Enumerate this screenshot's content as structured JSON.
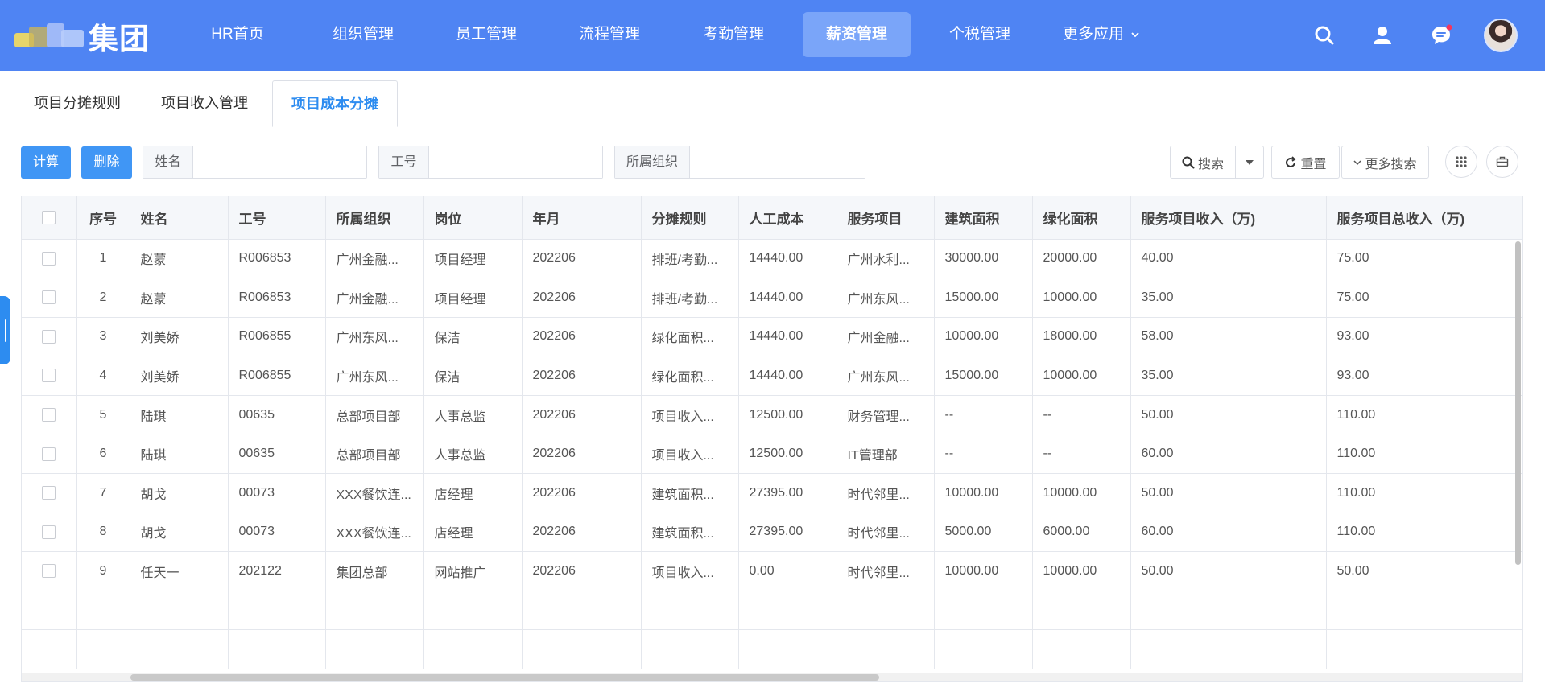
{
  "brand": {
    "logo_text": "集团"
  },
  "nav": {
    "items": [
      "HR首页",
      "组织管理",
      "员工管理",
      "流程管理",
      "考勤管理",
      "薪资管理",
      "个税管理",
      "更多应用"
    ],
    "active": "薪资管理"
  },
  "icons": [
    "search-icon",
    "user-icon",
    "message-icon",
    "avatar"
  ],
  "tabs": {
    "items": [
      "项目分摊规则",
      "项目收入管理",
      "项目成本分摊"
    ],
    "active": "项目成本分摊"
  },
  "toolbar": {
    "calc": "计算",
    "delete": "删除",
    "name_label": "姓名",
    "id_label": "工号",
    "org_label": "所属组织",
    "search": "搜索",
    "reset": "重置",
    "more_search": "更多搜索"
  },
  "table": {
    "headers": [
      "序号",
      "姓名",
      "工号",
      "所属组织",
      "岗位",
      "年月",
      "分摊规则",
      "人工成本",
      "服务项目",
      "建筑面积",
      "绿化面积",
      "服务项目收入（万)",
      "服务项目总收入（万)"
    ],
    "rows": [
      [
        "1",
        "赵蒙",
        "R006853",
        "广州金融...",
        "项目经理",
        "202206",
        "排班/考勤...",
        "14440.00",
        "广州水利...",
        "30000.00",
        "20000.00",
        "40.00",
        "75.00"
      ],
      [
        "2",
        "赵蒙",
        "R006853",
        "广州金融...",
        "项目经理",
        "202206",
        "排班/考勤...",
        "14440.00",
        "广州东风...",
        "15000.00",
        "10000.00",
        "35.00",
        "75.00"
      ],
      [
        "3",
        "刘美娇",
        "R006855",
        "广州东风...",
        "保洁",
        "202206",
        "绿化面积...",
        "14440.00",
        "广州金融...",
        "10000.00",
        "18000.00",
        "58.00",
        "93.00"
      ],
      [
        "4",
        "刘美娇",
        "R006855",
        "广州东风...",
        "保洁",
        "202206",
        "绿化面积...",
        "14440.00",
        "广州东风...",
        "15000.00",
        "10000.00",
        "35.00",
        "93.00"
      ],
      [
        "5",
        "陆琪",
        "00635",
        "总部项目部",
        "人事总监",
        "202206",
        "项目收入...",
        "12500.00",
        "财务管理...",
        "--",
        "--",
        "50.00",
        "110.00"
      ],
      [
        "6",
        "陆琪",
        "00635",
        "总部项目部",
        "人事总监",
        "202206",
        "项目收入...",
        "12500.00",
        "IT管理部",
        "--",
        "--",
        "60.00",
        "110.00"
      ],
      [
        "7",
        "胡戈",
        "00073",
        "XXX餐饮连...",
        "店经理",
        "202206",
        "建筑面积...",
        "27395.00",
        "时代邻里...",
        "10000.00",
        "10000.00",
        "50.00",
        "110.00"
      ],
      [
        "8",
        "胡戈",
        "00073",
        "XXX餐饮连...",
        "店经理",
        "202206",
        "建筑面积...",
        "27395.00",
        "时代邻里...",
        "5000.00",
        "6000.00",
        "60.00",
        "110.00"
      ],
      [
        "9",
        "任天一",
        "202122",
        "集团总部",
        "网站推广",
        "202206",
        "项目收入...",
        "0.00",
        "时代邻里...",
        "10000.00",
        "10000.00",
        "50.00",
        "50.00"
      ]
    ]
  },
  "colors": {
    "nav_bg": "#4f84f3",
    "accent": "#2d8cf0",
    "button": "#4096f5"
  }
}
